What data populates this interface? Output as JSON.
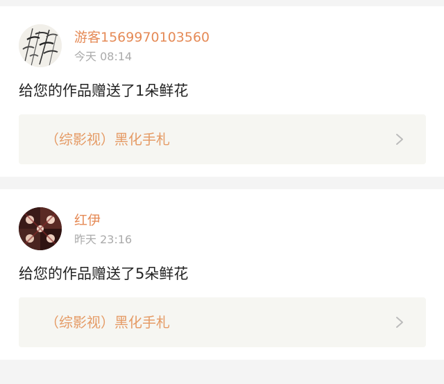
{
  "feed": [
    {
      "username": "游客1569970103560",
      "time": "今天 08:14",
      "message": "给您的作品赠送了1朵鲜花",
      "work_title": "（综影视）黑化手札"
    },
    {
      "username": "红伊",
      "time": "昨天 23:16",
      "message": "给您的作品赠送了5朵鲜花",
      "work_title": "（综影视）黑化手札"
    }
  ],
  "colors": {
    "username": "#e58a56",
    "work_title": "#e59b66",
    "time": "#aaaaaa",
    "message": "#222222",
    "link_background": "#f6f6f2",
    "page_background": "#f4f4f4"
  },
  "icons": {
    "link_arrow": "chevron-right-icon"
  }
}
